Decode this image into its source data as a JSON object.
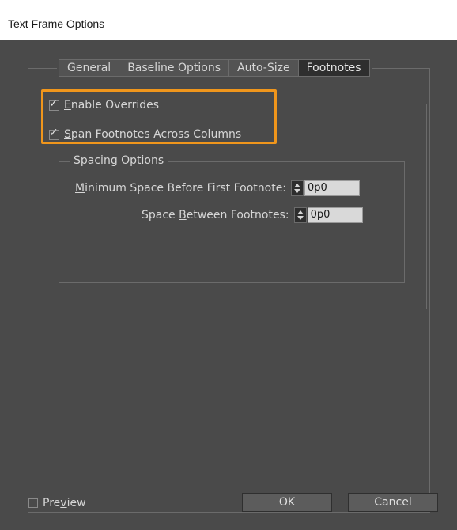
{
  "window": {
    "title": "Text Frame Options"
  },
  "tabs": [
    {
      "label": "General",
      "active": false
    },
    {
      "label": "Baseline Options",
      "active": false
    },
    {
      "label": "Auto-Size",
      "active": false
    },
    {
      "label": "Footnotes",
      "active": true
    }
  ],
  "footnotes": {
    "enable_overrides": {
      "label_mnemonic": "E",
      "label_rest": "nable Overrides",
      "checked": true
    },
    "span_across_columns": {
      "label_mnemonic": "S",
      "label_rest": "pan Footnotes Across Columns",
      "checked": true
    },
    "spacing_group_label": "Spacing Options",
    "min_space": {
      "label_mnemonic": "M",
      "label_rest": "inimum Space Before First Footnote:",
      "value": "0p0"
    },
    "space_between": {
      "label_prefix": "Space ",
      "label_mnemonic": "B",
      "label_rest": "etween Footnotes:",
      "value": "0p0"
    }
  },
  "footer": {
    "preview": {
      "label_prefix": "Pre",
      "label_mnemonic": "v",
      "label_rest": "iew",
      "checked": false
    },
    "ok_label": "OK",
    "cancel_label": "Cancel"
  },
  "colors": {
    "highlight": "#f0961c",
    "dialog_bg": "#4a4a4a"
  }
}
